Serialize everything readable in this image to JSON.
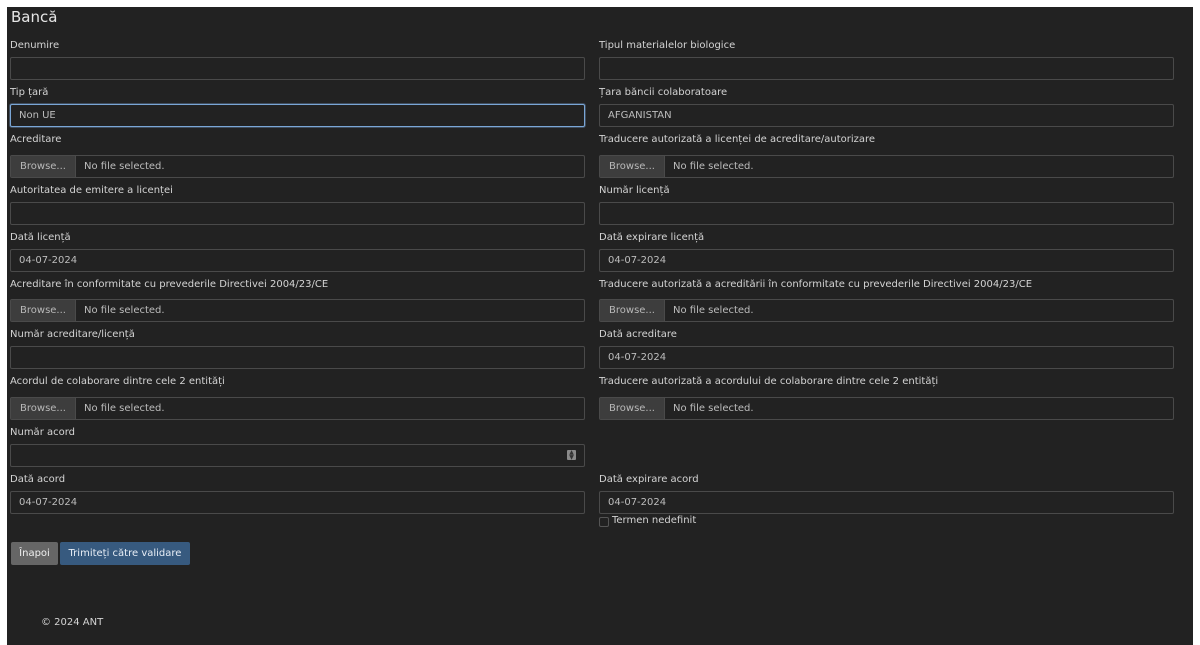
{
  "page": {
    "title": "Bancă"
  },
  "form": {
    "denumire": {
      "label": "Denumire",
      "value": ""
    },
    "tip_materiale": {
      "label": "Tipul materialelor biologice",
      "value": ""
    },
    "tip_tara": {
      "label": "Tip țară",
      "value": "Non UE"
    },
    "tara_banca": {
      "label": "Țara băncii colaboratoare",
      "value": "AFGANISTAN"
    },
    "acreditare": {
      "label": "Acreditare",
      "browse": "Browse...",
      "file": "No file selected."
    },
    "traducere_licenta": {
      "label": "Traducere autorizată a licenței de acreditare/autorizare",
      "browse": "Browse...",
      "file": "No file selected."
    },
    "autoritatea": {
      "label": "Autoritatea de emitere a licenței",
      "value": ""
    },
    "numar_licenta": {
      "label": "Număr licență",
      "value": ""
    },
    "data_licenta": {
      "label": "Dată licență",
      "value": "04-07-2024"
    },
    "data_expirare_licenta": {
      "label": "Dată expirare licență",
      "value": "04-07-2024"
    },
    "acreditare_directiva": {
      "label": "Acreditare în conformitate cu prevederile Directivei 2004/23/CE",
      "browse": "Browse...",
      "file": "No file selected."
    },
    "traducere_acreditare": {
      "label": "Traducere autorizată a acreditării în conformitate cu prevederile Directivei 2004/23/CE",
      "browse": "Browse...",
      "file": "No file selected."
    },
    "numar_acreditare": {
      "label": "Număr acreditare/licență",
      "value": ""
    },
    "data_acreditare": {
      "label": "Dată acreditare",
      "value": "04-07-2024"
    },
    "acord_colaborare": {
      "label": "Acordul de colaborare dintre cele 2 entități",
      "browse": "Browse...",
      "file": "No file selected."
    },
    "traducere_acord": {
      "label": "Traducere autorizată a acordului de colaborare dintre cele 2 entități",
      "browse": "Browse...",
      "file": "No file selected."
    },
    "numar_acord": {
      "label": "Număr acord",
      "value": ""
    },
    "data_acord": {
      "label": "Dată acord",
      "value": "04-07-2024"
    },
    "data_expirare_acord": {
      "label": "Dată expirare acord",
      "value": "04-07-2024"
    },
    "termen_nedefinit": {
      "label": "Termen nedefinit",
      "checked": false
    }
  },
  "buttons": {
    "back": "Înapoi",
    "submit": "Trimiteți către validare"
  },
  "footer": {
    "text": "© 2024 ANT"
  }
}
